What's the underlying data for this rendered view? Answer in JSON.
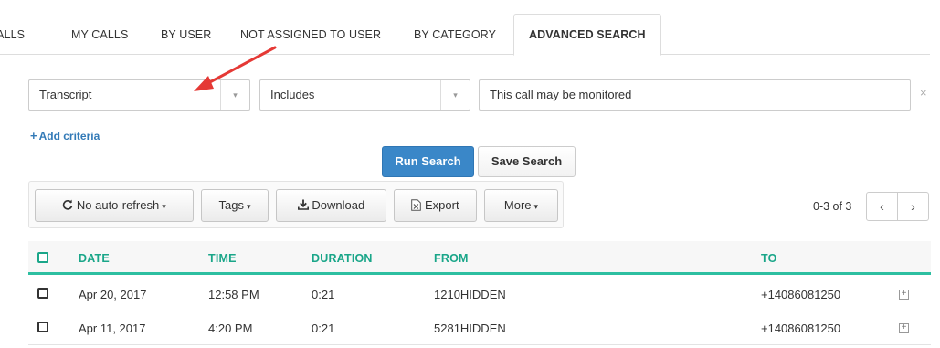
{
  "tabs": [
    {
      "label": "CALLS"
    },
    {
      "label": "MY CALLS"
    },
    {
      "label": "BY USER"
    },
    {
      "label": "NOT ASSIGNED TO USER"
    },
    {
      "label": "BY CATEGORY"
    },
    {
      "label": "ADVANCED SEARCH",
      "active": true
    }
  ],
  "criteria": {
    "field_value": "Transcript",
    "operator_value": "Includes",
    "text_value": "This call may be monitored",
    "remove_glyph": "×",
    "add_label": "Add criteria",
    "add_glyph": "+"
  },
  "actions": {
    "run_search": "Run Search",
    "save_search": "Save Search"
  },
  "toolbar": {
    "refresh_label": "No auto-refresh",
    "refresh_icon": "refresh-icon",
    "tags_label": "Tags",
    "download_label": "Download",
    "download_icon": "download-icon",
    "export_label": "Export",
    "export_icon": "excel-file-icon",
    "more_label": "More",
    "caret": "▾"
  },
  "pager": {
    "summary": "0-3 of 3",
    "prev": "‹",
    "next": "›"
  },
  "table": {
    "columns": [
      "DATE",
      "TIME",
      "DURATION",
      "FROM",
      "TO"
    ],
    "rows": [
      {
        "date": "Apr 20, 2017",
        "time": "12:58 PM",
        "duration": "0:21",
        "from": "1210HIDDEN",
        "to": "+14086081250"
      },
      {
        "date": "Apr 11, 2017",
        "time": "4:20 PM",
        "duration": "0:21",
        "from": "5281HIDDEN",
        "to": "+14086081250"
      }
    ],
    "expand_glyph": "+"
  },
  "colors": {
    "accent": "#1aa689",
    "primary_button": "#3a87c8",
    "annotation_arrow": "#e53935"
  }
}
